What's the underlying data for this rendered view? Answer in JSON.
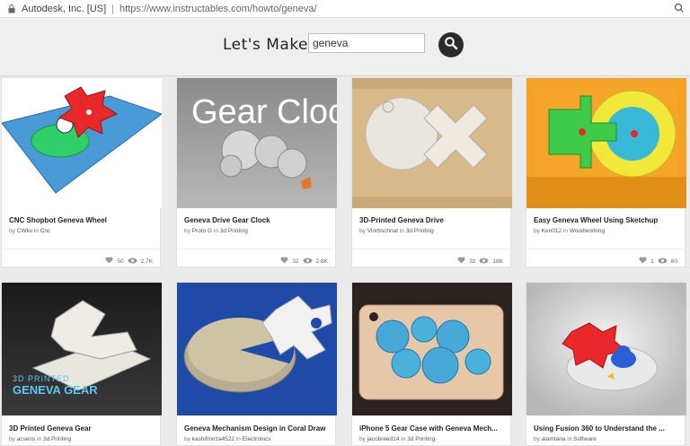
{
  "browser": {
    "org": "Autodesk, Inc. [US]",
    "separator": "|",
    "url": "https://www.instructables.com/howto/geneva/"
  },
  "header": {
    "brand": "Let's Make",
    "search_value": "geneva"
  },
  "cards": [
    {
      "title": "CNC Shopbot Geneva Wheel",
      "by": "by",
      "author": "CWkv",
      "in": "in",
      "category": "Cnc",
      "favorites": "50",
      "views": "2.7K"
    },
    {
      "title": "Geneva Drive Gear Clock",
      "by": "by",
      "author": "Proto G",
      "in": "in",
      "category": "3d Printing",
      "favorites": "32",
      "views": "2.6K",
      "overlay_text": "Gear Clock"
    },
    {
      "title": "3D-Printed Geneva Drive",
      "by": "by",
      "author": "Vlorbschnat",
      "in": "in",
      "category": "3d Printing",
      "favorites": "32",
      "views": "18K"
    },
    {
      "title": "Easy Geneva Wheel Using Sketchup",
      "by": "by",
      "author": "Ken012",
      "in": "in",
      "category": "Woodworking",
      "favorites": "1",
      "views": "60"
    },
    {
      "title": "3D Printed Geneva Gear",
      "by": "by",
      "author": "acsens",
      "in": "in",
      "category": "3d Printing",
      "overlay_line1": "3D PRINTED",
      "overlay_line2": "GENEVA GEAR"
    },
    {
      "title": "Geneva Mechanism Design in Coral Draw",
      "by": "by",
      "author": "kashifmirza4522",
      "in": "in",
      "category": "Electronics"
    },
    {
      "title": "iPhone 5 Gear Case with Geneva Mech...",
      "by": "by",
      "author": "jacobreed14",
      "in": "in",
      "category": "3d Printing"
    },
    {
      "title": "Using Fusion 360 to Understand the ...",
      "by": "by",
      "author": "alamtaria",
      "in": "in",
      "category": "Software"
    }
  ],
  "colors": {
    "accent_red": "#e8282b",
    "green": "#26c26b",
    "blue": "#3a8fd6"
  },
  "icons": {
    "lock": "lock-icon",
    "search": "search-icon",
    "heart": "heart-icon",
    "eye": "eye-icon"
  }
}
